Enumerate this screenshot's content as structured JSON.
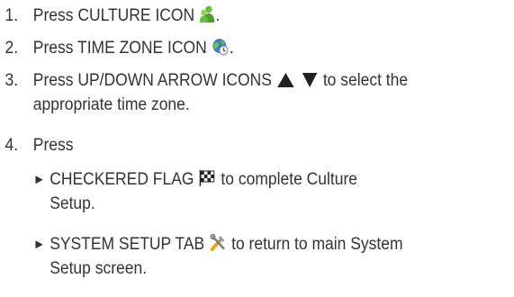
{
  "steps": [
    {
      "number": "1.",
      "before": "Press CULTURE ICON",
      "after": ".",
      "icon": "people-icon"
    },
    {
      "number": "2.",
      "before": "Press TIME ZONE ICON",
      "after": ".",
      "icon": "globe-clock-icon"
    },
    {
      "number": "3.",
      "before": "Press UP/DOWN ARROW ICONS",
      "after_line1": "to select the",
      "line2": "appropriate time zone.",
      "icons": [
        "up-triangle-icon",
        "down-triangle-icon"
      ]
    },
    {
      "number": "4.",
      "text": "Press",
      "subitems": [
        {
          "bullet": "►",
          "before": "CHECKERED FLAG",
          "after": "to complete Culture",
          "line2": "Setup.",
          "icon": "checkered-flag-icon"
        },
        {
          "bullet": "►",
          "before": "SYSTEM SETUP TAB",
          "after": "to return to main System",
          "line2": "Setup screen.",
          "icon": "tools-icon"
        }
      ]
    }
  ],
  "colors": {
    "text": "#333333",
    "people_icon": "#5aa83a",
    "globe_icon": "#3b7fc4",
    "triangles": "#222222",
    "tools_icon": "#e8a317"
  }
}
